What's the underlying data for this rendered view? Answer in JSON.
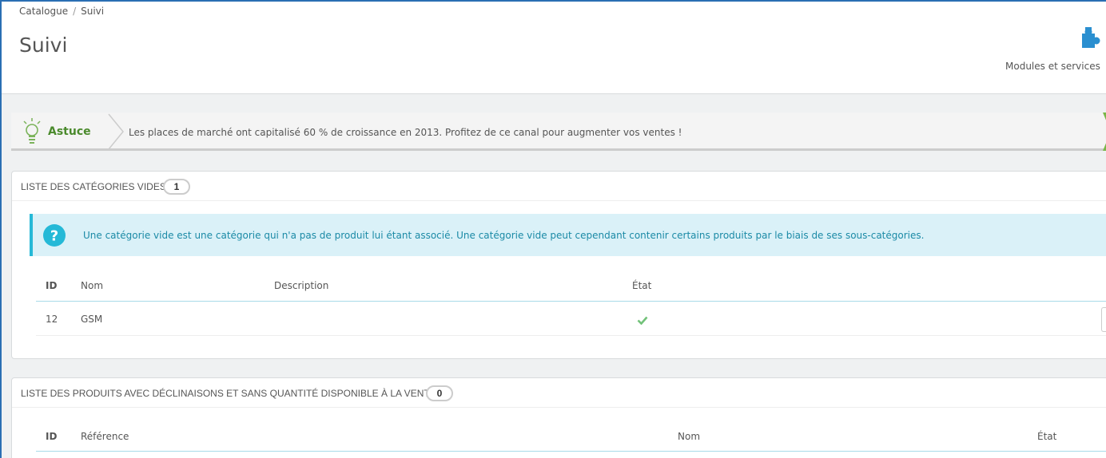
{
  "breadcrumb": {
    "parent": "Catalogue",
    "separator": "/",
    "current": "Suivi"
  },
  "page_title": "Suivi",
  "toolbar": {
    "modules_label": "Modules et services",
    "modules_icon": "puzzle-icon"
  },
  "tip": {
    "title": "Astuce",
    "text": "Les places de marché ont capitalisé 60 % de croissance en 2013. Profitez de ce canal pour augmenter vos ventes !",
    "icon": "lightbulb-icon"
  },
  "empty_categories": {
    "title": "Liste des catégories vides",
    "count": "1",
    "info": "Une catégorie vide est une catégorie qui n'a pas de produit lui étant associé. Une catégorie vide peut cependant contenir certains produits par le biais de ses sous-catégories.",
    "columns": {
      "id": "ID",
      "name": "Nom",
      "description": "Description",
      "status": "État"
    },
    "rows": [
      {
        "id": "12",
        "name": "GSM",
        "description": "",
        "status_icon": "check-icon"
      }
    ]
  },
  "products_no_stock": {
    "title": "Liste des produits avec déclinaisons et sans quantité disponible à la vente",
    "count": "0",
    "columns": {
      "id": "ID",
      "reference": "Référence",
      "name": "Nom",
      "status": "État"
    }
  },
  "colors": {
    "accent": "#25b9d7",
    "success": "#72c279",
    "tip_green": "#4a8a2c",
    "brand_blue": "#2a6fb3"
  }
}
